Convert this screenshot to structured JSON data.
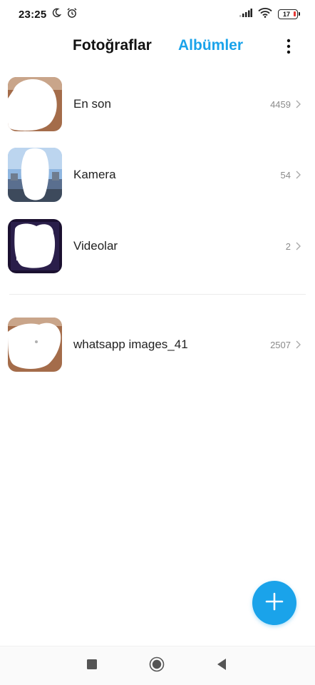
{
  "status_bar": {
    "time": "23:25",
    "battery_level": "17",
    "icons": [
      "moon-icon",
      "alarm-icon",
      "signal-icon",
      "wifi-icon",
      "battery-icon"
    ]
  },
  "header": {
    "tabs": [
      {
        "label": "Fotoğraflar",
        "active": false
      },
      {
        "label": "Albümler",
        "active": true
      }
    ],
    "menu_icon": "more-vertical-icon"
  },
  "albums": [
    {
      "name": "En son",
      "count": "4459"
    },
    {
      "name": "Kamera",
      "count": "54"
    },
    {
      "name": "Videolar",
      "count": "2"
    },
    {
      "name": "whatsapp images_41",
      "count": "2507"
    }
  ],
  "fab": {
    "icon": "plus-icon"
  },
  "nav_bar": {
    "icons": [
      "recents-icon",
      "home-icon",
      "back-icon"
    ]
  },
  "colors": {
    "accent": "#1aa3ea",
    "text_primary": "#222222",
    "text_secondary": "#8a8a8a",
    "battery_low": "#e53935"
  }
}
